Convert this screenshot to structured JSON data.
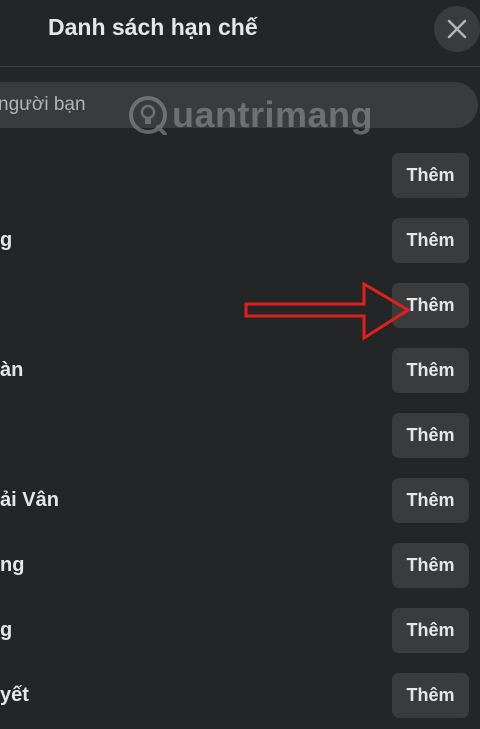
{
  "header": {
    "title": "Danh sách hạn chế"
  },
  "search": {
    "placeholder": "người bạn",
    "value": ""
  },
  "watermark": {
    "text": "uantrimang"
  },
  "friends": [
    {
      "name": "",
      "button": "Thêm"
    },
    {
      "name": "g",
      "button": "Thêm"
    },
    {
      "name": "",
      "button": "Thêm"
    },
    {
      "name": "àn",
      "button": "Thêm"
    },
    {
      "name": "",
      "button": "Thêm"
    },
    {
      "name": "ải Vân",
      "button": "Thêm"
    },
    {
      "name": "ng",
      "button": "Thêm"
    },
    {
      "name": "g",
      "button": "Thêm"
    },
    {
      "name": "yết",
      "button": "Thêm"
    }
  ],
  "colors": {
    "background": "#242526",
    "button": "#3a3b3c",
    "text": "#e4e6eb",
    "arrow": "#e0201c"
  }
}
